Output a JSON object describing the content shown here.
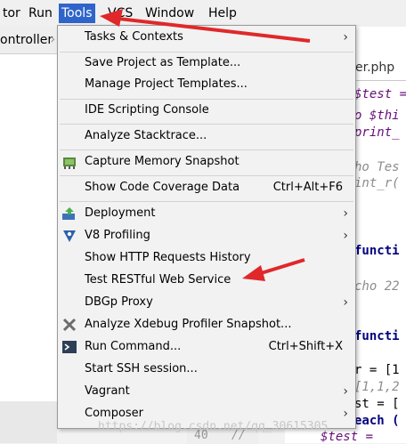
{
  "menubar": {
    "items": [
      {
        "label": "tor"
      },
      {
        "label": "Run"
      },
      {
        "label": "Tools"
      },
      {
        "label": "VCS"
      },
      {
        "label": "Window"
      },
      {
        "label": "Help"
      }
    ]
  },
  "toolbar": {
    "crumb": "ontroller"
  },
  "editor": {
    "tab_label": "er.php",
    "lines": [
      "$test = n",
      "o $thi",
      "print_",
      "ho Tes",
      "int_r(",
      "functi",
      "cho 22",
      "functi",
      "r = [1",
      "[1,1,2",
      "st = [",
      "each (",
      "$test ="
    ],
    "line_number": "40",
    "comment": "//"
  },
  "watermark": "https://blog.csdn.net/qq_30615305",
  "tools_menu": {
    "items": [
      {
        "label": "Tasks & Contexts",
        "mnemonic": "T",
        "shortcut": "",
        "submenu": true,
        "icon": ""
      },
      {
        "label": "Save Project as Template...",
        "shortcut": "",
        "submenu": false,
        "icon": ""
      },
      {
        "label": "Manage Project Templates...",
        "shortcut": "",
        "submenu": false,
        "icon": ""
      },
      {
        "label": "IDE Scripting Console",
        "shortcut": "",
        "submenu": false,
        "icon": ""
      },
      {
        "label": "Analyze Stacktrace...",
        "shortcut": "",
        "submenu": false,
        "icon": ""
      },
      {
        "label": "Capture Memory Snapshot",
        "shortcut": "",
        "submenu": false,
        "icon": "memory-chip-icon"
      },
      {
        "label": "Show Code Coverage Data",
        "shortcut": "Ctrl+Alt+F6",
        "submenu": false,
        "icon": ""
      },
      {
        "label": "Deployment",
        "shortcut": "",
        "submenu": true,
        "icon": "deployment-icon"
      },
      {
        "label": "V8 Profiling",
        "shortcut": "",
        "submenu": true,
        "icon": "v8-icon"
      },
      {
        "label": "Show HTTP Requests History",
        "shortcut": "",
        "submenu": false,
        "icon": ""
      },
      {
        "label": "Test RESTful Web Service",
        "shortcut": "",
        "submenu": false,
        "icon": ""
      },
      {
        "label": "DBGp Proxy",
        "shortcut": "",
        "submenu": true,
        "icon": ""
      },
      {
        "label": "Analyze Xdebug Profiler Snapshot...",
        "shortcut": "",
        "submenu": false,
        "icon": "xdebug-icon"
      },
      {
        "label": "Run Command...",
        "shortcut": "Ctrl+Shift+X",
        "submenu": false,
        "icon": "terminal-icon"
      },
      {
        "label": "Start SSH session...",
        "shortcut": "",
        "submenu": false,
        "icon": ""
      },
      {
        "label": "Vagrant",
        "shortcut": "",
        "submenu": true,
        "icon": ""
      },
      {
        "label": "Composer",
        "shortcut": "",
        "submenu": true,
        "icon": ""
      }
    ]
  },
  "colors": {
    "menu_highlight": "#2f65ca",
    "arrow": "#e0282a"
  }
}
